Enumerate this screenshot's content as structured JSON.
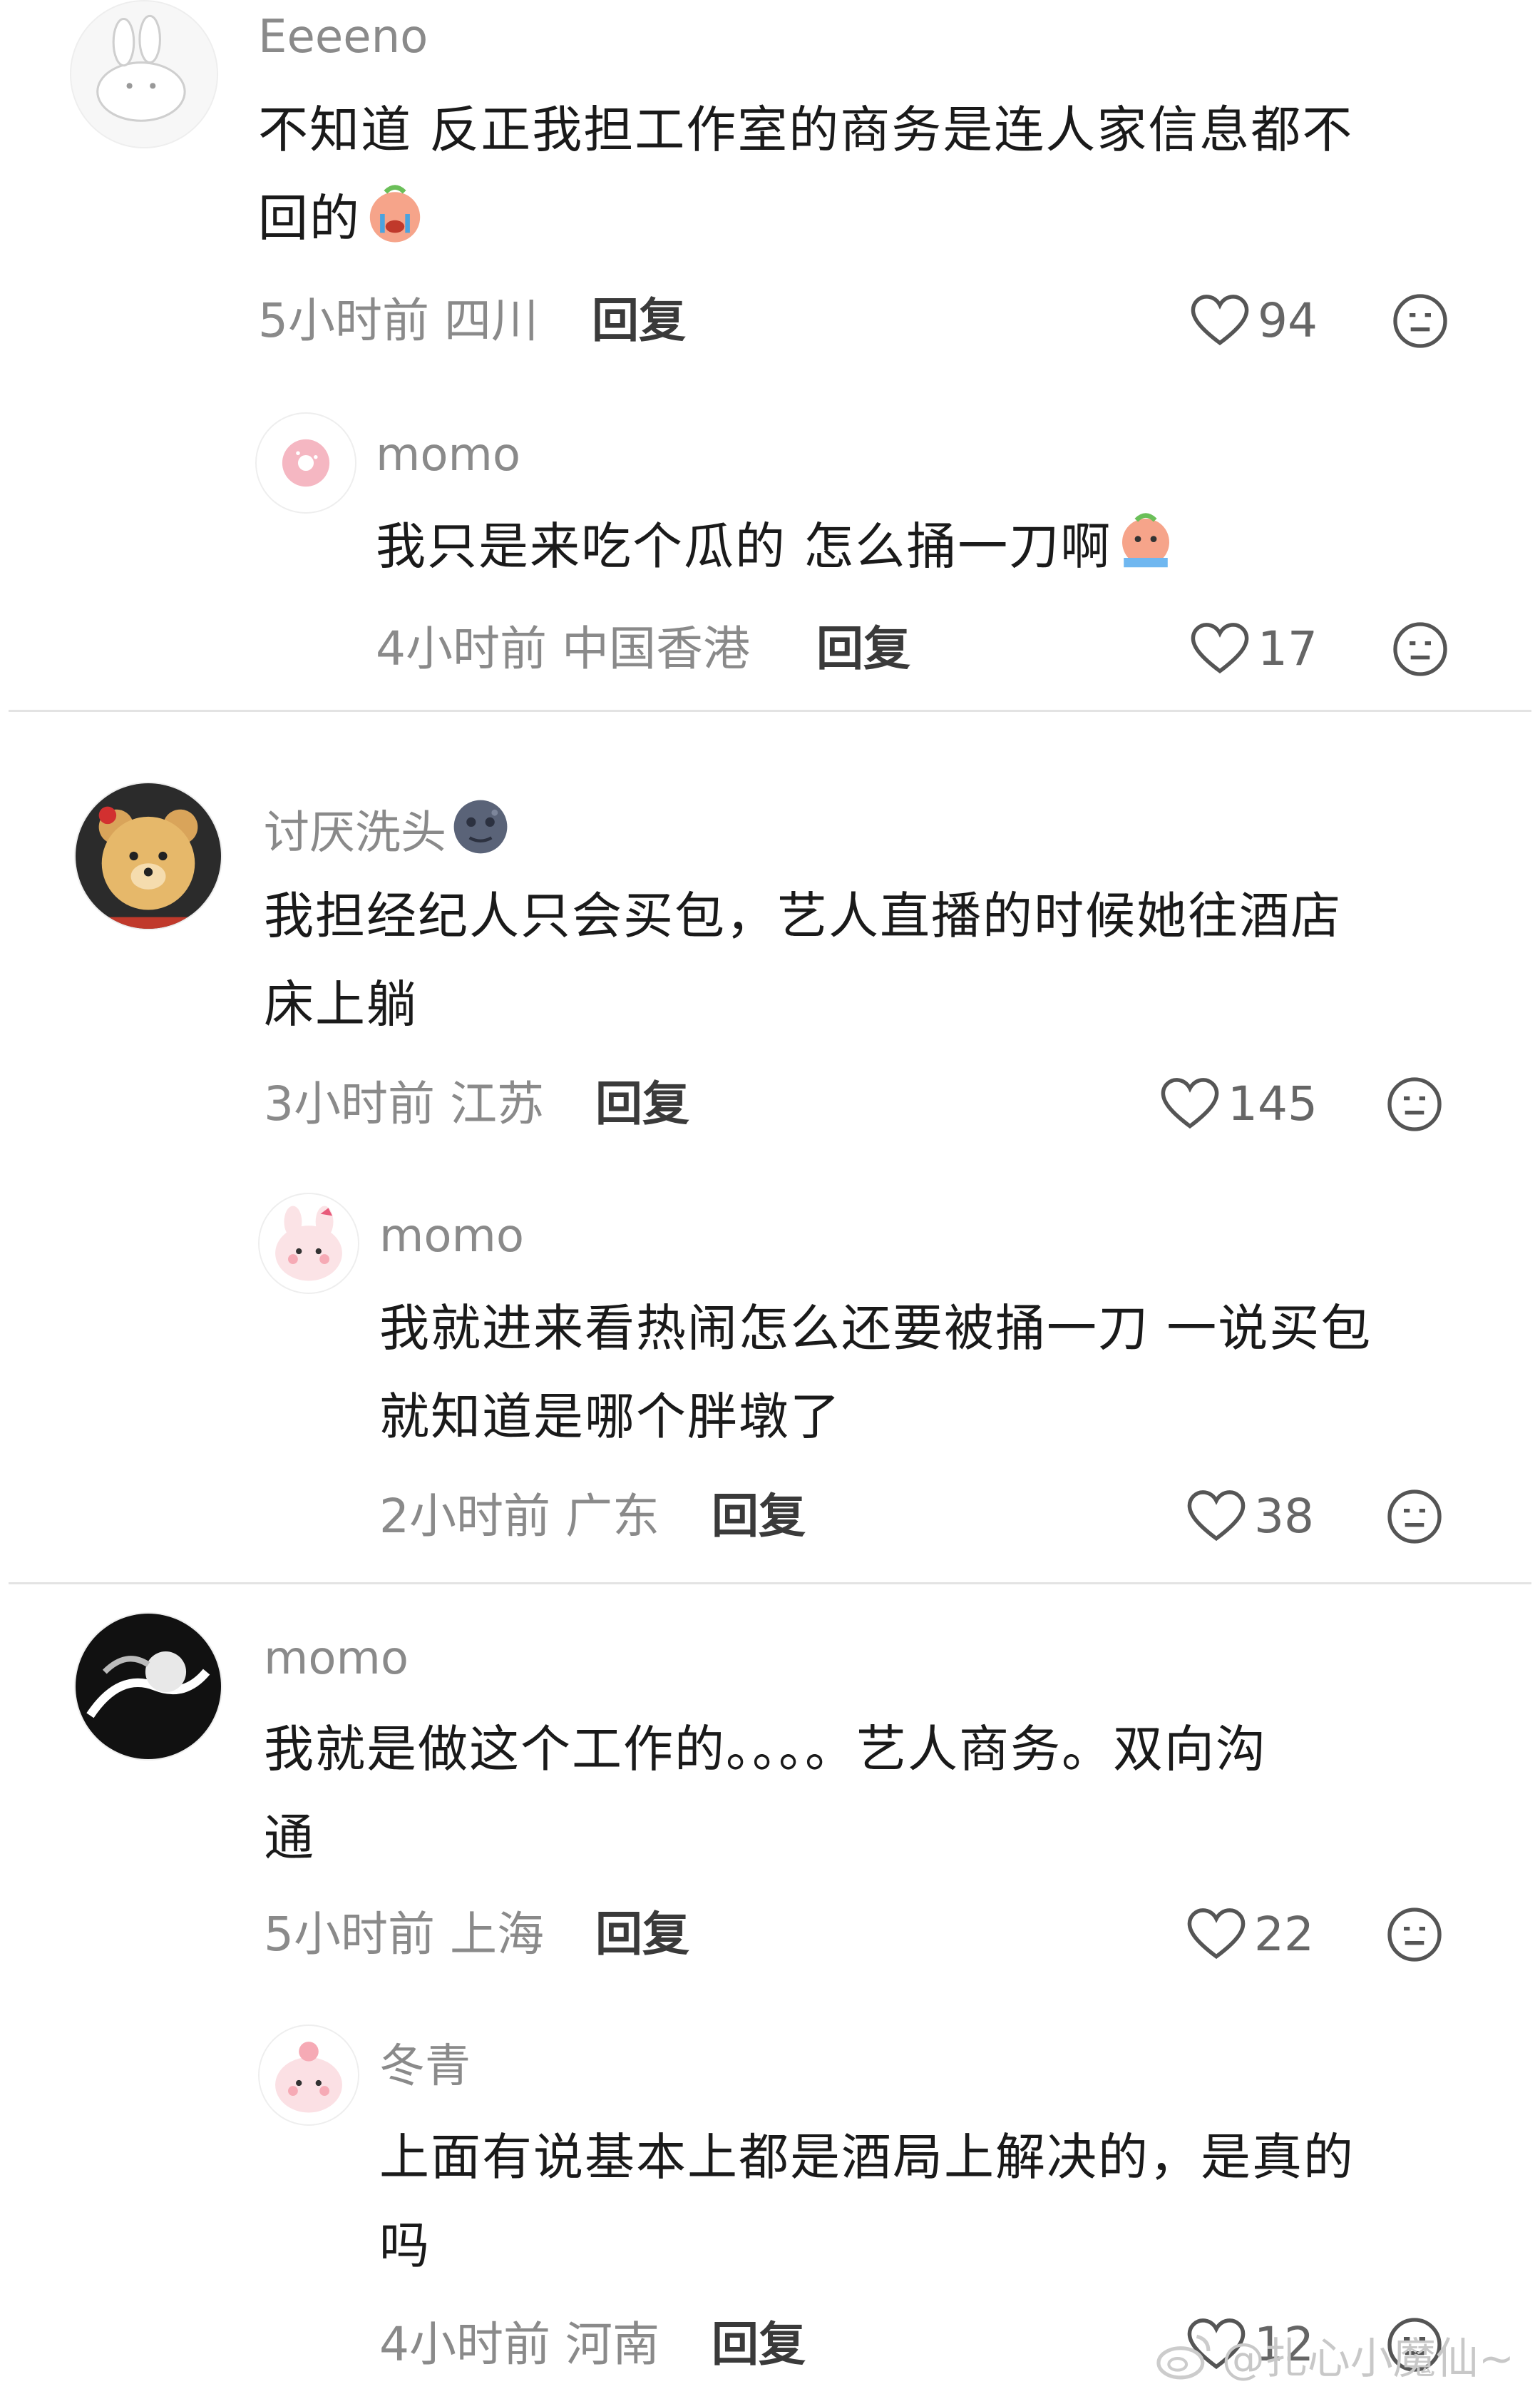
{
  "comments": [
    {
      "author": "Eeeeno",
      "lines": [
        "不知道 反正我担工作室的商务是连人家信息都不",
        "回的"
      ],
      "emoji": "crying-face-emoji",
      "time": "5小时前",
      "location": "四川",
      "reply_label": "回复",
      "likes": "94",
      "avatar": "white-bunny-avatar",
      "replies": [
        {
          "author": "momo",
          "lines": [
            "我只是来吃个瓜的 怎么捅一刀啊"
          ],
          "emoji": "crying-face-emoji",
          "time": "4小时前",
          "location": "中国香港",
          "reply_label": "回复",
          "likes": "17",
          "avatar": "pink-donut-avatar"
        }
      ]
    },
    {
      "author": "讨厌洗头",
      "author_emoji": "new-moon-face-emoji",
      "lines": [
        "我担经纪人只会买包，艺人直播的时候她往酒店",
        "床上躺"
      ],
      "time": "3小时前",
      "location": "江苏",
      "reply_label": "回复",
      "likes": "145",
      "avatar": "teddy-bear-avatar",
      "replies": [
        {
          "author": "momo",
          "lines": [
            "我就进来看热闹怎么还要被捅一刀 一说买包",
            "就知道是哪个胖墩了"
          ],
          "time": "2小时前",
          "location": "广东",
          "reply_label": "回复",
          "likes": "38",
          "avatar": "pink-bunny-avatar"
        }
      ]
    },
    {
      "author": "momo",
      "lines": [
        "我就是做这个工作的。。。。艺人商务。双向沟",
        "通"
      ],
      "time": "5小时前",
      "location": "上海",
      "reply_label": "回复",
      "likes": "22",
      "avatar": "black-white-art-avatar",
      "replies": [
        {
          "author": "冬青",
          "lines": [
            "上面有说基本上都是酒局上解决的，是真的",
            "吗"
          ],
          "time": "4小时前",
          "location": "河南",
          "reply_label": "回复",
          "likes": "12",
          "avatar": "pink-bunny-avatar"
        }
      ]
    }
  ],
  "watermark": "@扎心小魔仙~",
  "colors": {
    "text": "#1a1a1a",
    "muted": "#8a8a8a",
    "divider": "#e3e3e3",
    "background": "#ffffff"
  }
}
